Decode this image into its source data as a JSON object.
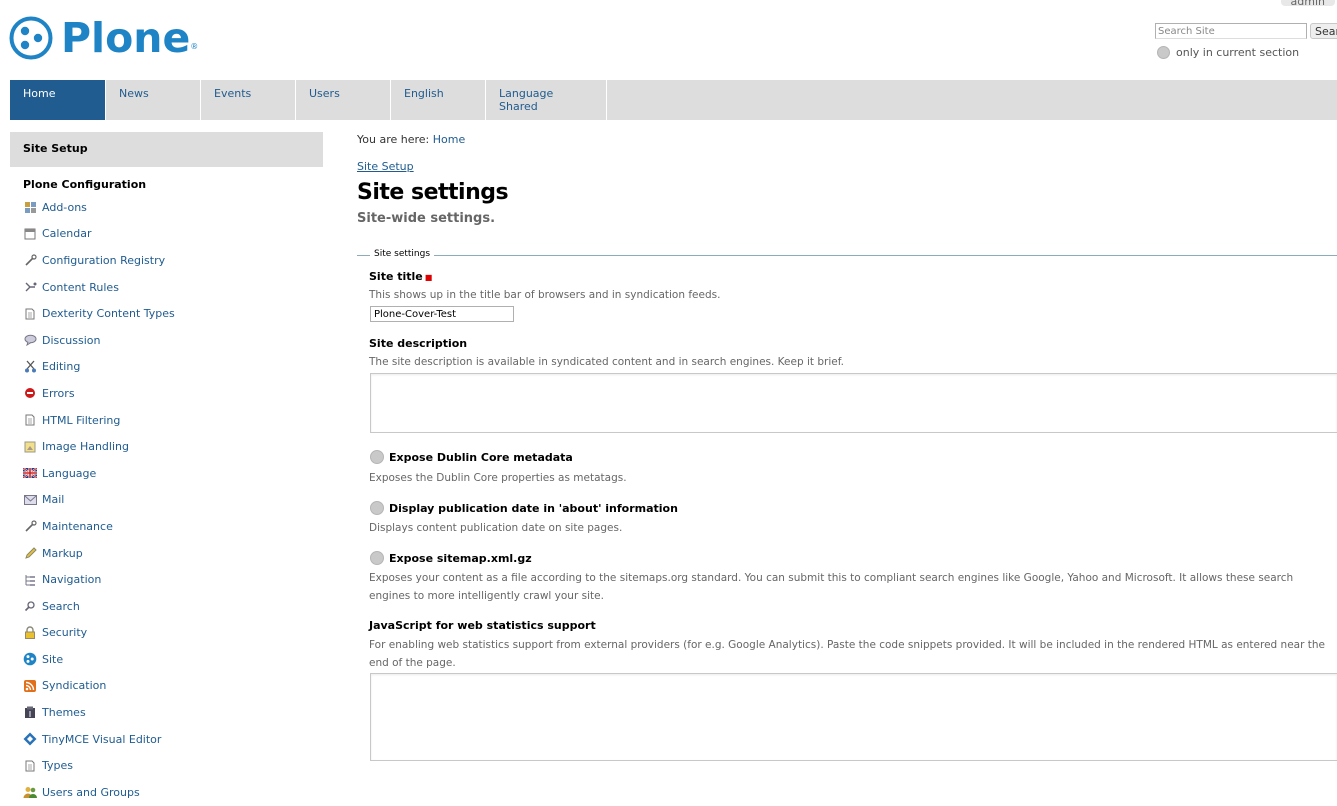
{
  "header": {
    "user_name": "admin",
    "logo_text": "Plone",
    "logo_mark": "®",
    "search_placeholder": "Search Site",
    "search_button": "Sear",
    "current_section_label": "only in current section"
  },
  "nav": {
    "tabs": [
      {
        "label": "Home"
      },
      {
        "label": "News"
      },
      {
        "label": "Events"
      },
      {
        "label": "Users"
      },
      {
        "label": "English"
      },
      {
        "label": "Language Shared"
      }
    ]
  },
  "portlet": {
    "title": "Site Setup",
    "group": "Plone Configuration",
    "items": [
      {
        "label": "Add-ons",
        "icon": "addons-icon"
      },
      {
        "label": "Calendar",
        "icon": "calendar-icon"
      },
      {
        "label": "Configuration Registry",
        "icon": "wrench-icon"
      },
      {
        "label": "Content Rules",
        "icon": "content-rules-icon"
      },
      {
        "label": "Dexterity Content Types",
        "icon": "document-icon"
      },
      {
        "label": "Discussion",
        "icon": "discussion-icon"
      },
      {
        "label": "Editing",
        "icon": "scissors-icon"
      },
      {
        "label": "Errors",
        "icon": "error-icon"
      },
      {
        "label": "HTML Filtering",
        "icon": "document-icon"
      },
      {
        "label": "Image Handling",
        "icon": "image-icon"
      },
      {
        "label": "Language",
        "icon": "flag-icon"
      },
      {
        "label": "Mail",
        "icon": "mail-icon"
      },
      {
        "label": "Maintenance",
        "icon": "wrench-icon"
      },
      {
        "label": "Markup",
        "icon": "pencil-icon"
      },
      {
        "label": "Navigation",
        "icon": "navigation-icon"
      },
      {
        "label": "Search",
        "icon": "search-icon"
      },
      {
        "label": "Security",
        "icon": "lock-icon"
      },
      {
        "label": "Site",
        "icon": "plone-icon"
      },
      {
        "label": "Syndication",
        "icon": "rss-icon"
      },
      {
        "label": "Themes",
        "icon": "themes-icon"
      },
      {
        "label": "TinyMCE Visual Editor",
        "icon": "tinymce-icon"
      },
      {
        "label": "Types",
        "icon": "document-icon"
      },
      {
        "label": "Users and Groups",
        "icon": "users-icon"
      }
    ]
  },
  "breadcrumbs": {
    "prefix": "You are here:",
    "home": "Home"
  },
  "main": {
    "site_setup_link": "Site Setup",
    "title": "Site settings",
    "description": "Site-wide settings.",
    "fieldset_legend": "Site settings",
    "site_title": {
      "label": "Site title",
      "help": "This shows up in the title bar of browsers and in syndication feeds.",
      "value": "Plone-Cover-Test"
    },
    "site_description": {
      "label": "Site description",
      "help": "The site description is available in syndicated content and in search engines. Keep it brief.",
      "value": ""
    },
    "dublin_core": {
      "label": "Expose Dublin Core metadata",
      "help": "Exposes the Dublin Core properties as metatags."
    },
    "publication_date": {
      "label": "Display publication date in 'about' information",
      "help": "Displays content publication date on site pages."
    },
    "sitemap": {
      "label": "Expose sitemap.xml.gz",
      "help": "Exposes your content as a file according to the sitemaps.org standard. You can submit this to compliant search engines like Google, Yahoo and Microsoft. It allows these search engines to more intelligently crawl your site."
    },
    "webstats": {
      "label": "JavaScript for web statistics support",
      "help": "For enabling web statistics support from external providers (for e.g. Google Analytics). Paste the code snippets provided. It will be included in the rendered HTML as entered near the end of the page.",
      "value": ""
    }
  },
  "colors": {
    "brand": "#1f84c5",
    "nav_active": "#205c90",
    "nav_bg": "#dddddd",
    "link": "#205c90",
    "required": "#dd0000"
  }
}
